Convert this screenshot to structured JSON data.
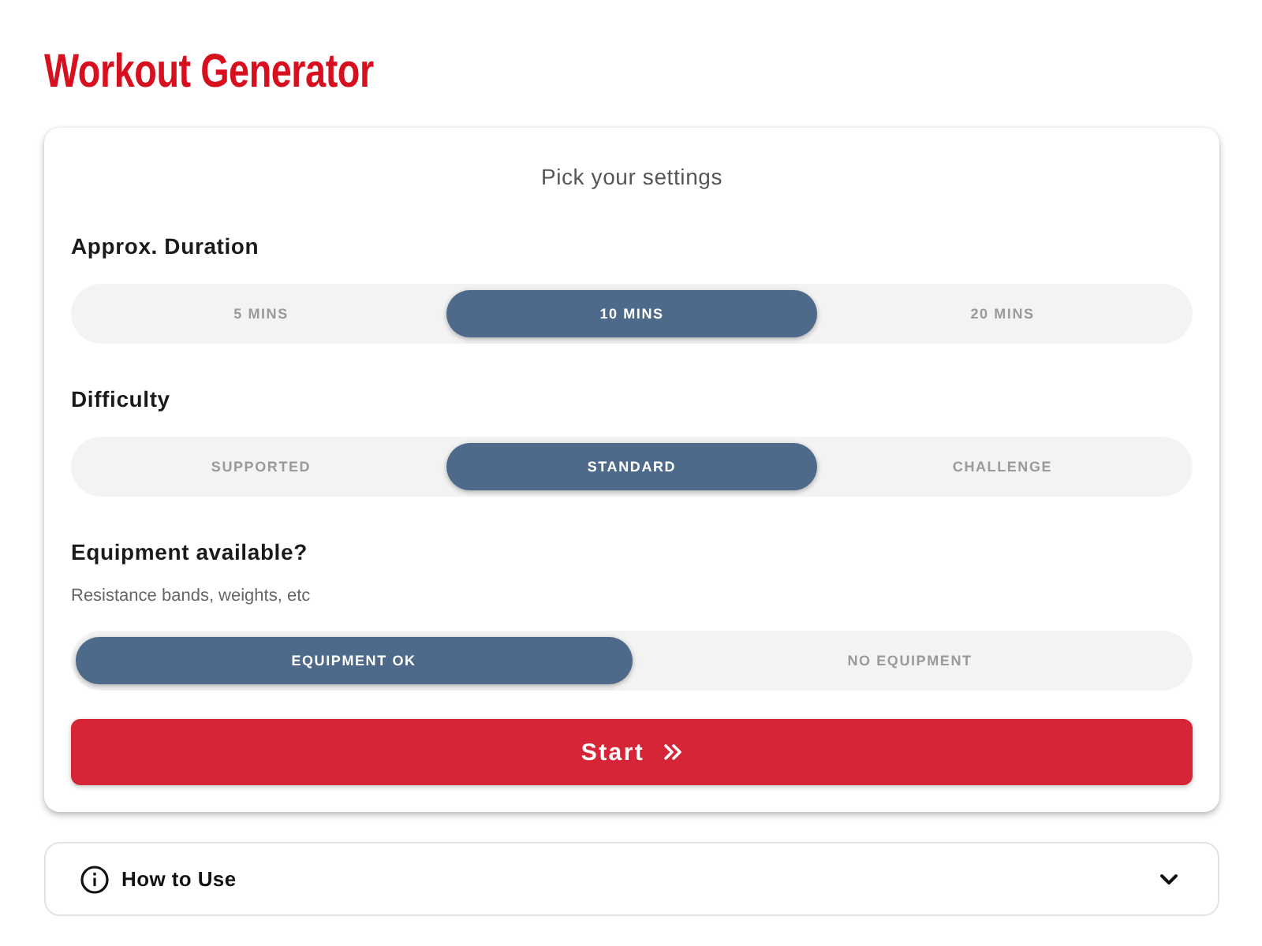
{
  "title": "Workout Generator",
  "settings": {
    "heading": "Pick your settings",
    "groups": [
      {
        "label": "Approx. Duration",
        "options": [
          {
            "label": "5 MINS",
            "selected": false
          },
          {
            "label": "10 MINS",
            "selected": true
          },
          {
            "label": "20 MINS",
            "selected": false
          }
        ]
      },
      {
        "label": "Difficulty",
        "options": [
          {
            "label": "SUPPORTED",
            "selected": false
          },
          {
            "label": "STANDARD",
            "selected": true
          },
          {
            "label": "CHALLENGE",
            "selected": false
          }
        ]
      },
      {
        "label": "Equipment available?",
        "hint": "Resistance bands, weights, etc",
        "options": [
          {
            "label": "EQUIPMENT OK",
            "selected": true
          },
          {
            "label": "NO EQUIPMENT",
            "selected": false
          }
        ]
      }
    ],
    "start_button": "Start"
  },
  "accordion": {
    "label": "How to Use",
    "expanded": false
  }
}
